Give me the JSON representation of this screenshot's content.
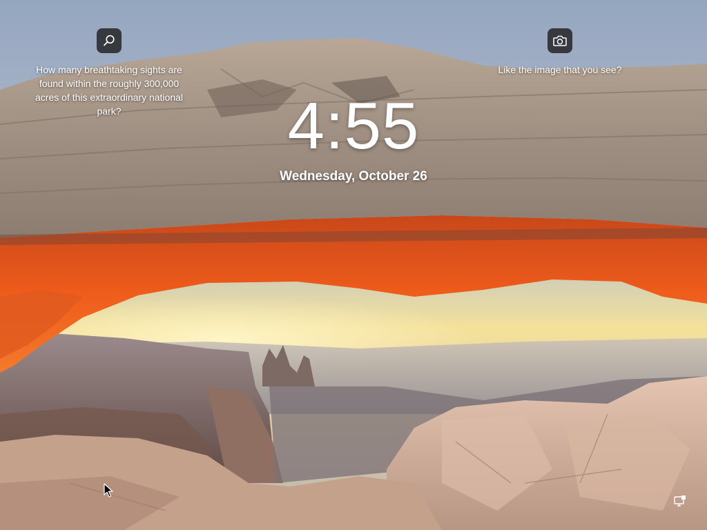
{
  "lockscreen": {
    "time": "4:55",
    "date": "Wednesday, October 26",
    "spotlight_learn": {
      "icon": "search-icon",
      "text": "How many breathtaking sights are found within the roughly 300,000 acres of this extraordinary national park?"
    },
    "spotlight_like": {
      "icon": "camera-icon",
      "text": "Like the image that you see?"
    },
    "status_icons": [
      "network-icon"
    ]
  },
  "background": {
    "scene": "desert-arch-sunrise",
    "colors": {
      "sky_top": "#9fb0c8",
      "sky_glow": "#f3dc8a",
      "arch_rock": "#a89788",
      "arch_underside": "#e2531a",
      "canyon": "#8a6a58",
      "foreground_rock": "#c9a792"
    }
  }
}
